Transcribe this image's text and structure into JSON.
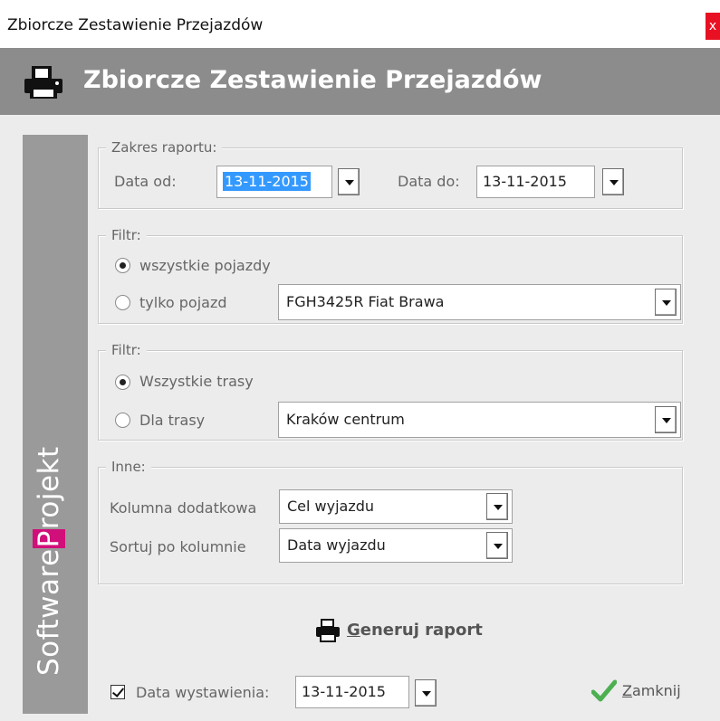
{
  "window": {
    "title": "Zbiorcze Zestawienie Przejazdów",
    "close_glyph": "x"
  },
  "header": {
    "title": "Zbiorcze Zestawienie Przejazdów",
    "icon": "printer-icon"
  },
  "sidebar": {
    "brand_before": "Software",
    "brand_highlight": "P",
    "brand_after": "rojekt"
  },
  "range": {
    "legend": "Zakres raportu:",
    "from_label": "Data od:",
    "from_value": "13-11-2015",
    "to_label": "Data do:",
    "to_value": "13-11-2015"
  },
  "vehicle_filter": {
    "legend": "Filtr:",
    "option_all": "wszystkie pojazdy",
    "option_only": "tylko pojazd",
    "selected": "all",
    "vehicle_value": "FGH3425R Fiat Brawa"
  },
  "route_filter": {
    "legend": "Filtr:",
    "option_all": "Wszystkie trasy",
    "option_one": "Dla trasy",
    "selected": "all",
    "route_value": "Kraków centrum"
  },
  "other": {
    "legend": "Inne:",
    "extra_column_label": "Kolumna dodatkowa",
    "extra_column_value": "Cel wyjazdu",
    "sort_label": "Sortuj po kolumnie",
    "sort_value": "Data wyjazdu"
  },
  "actions": {
    "generate_mnemonic": "G",
    "generate_rest": "eneruj raport",
    "close_mnemonic": "Z",
    "close_rest": "amknij"
  },
  "issue_date": {
    "checked": true,
    "label": "Data wystawienia:",
    "value": "13-11-2015"
  },
  "colors": {
    "header_bg": "#8c8c8c",
    "sidebar_bg": "#9a9a9a",
    "brand_accent": "#d10f7a",
    "selection": "#3399ff",
    "check_green": "#4caf50"
  }
}
